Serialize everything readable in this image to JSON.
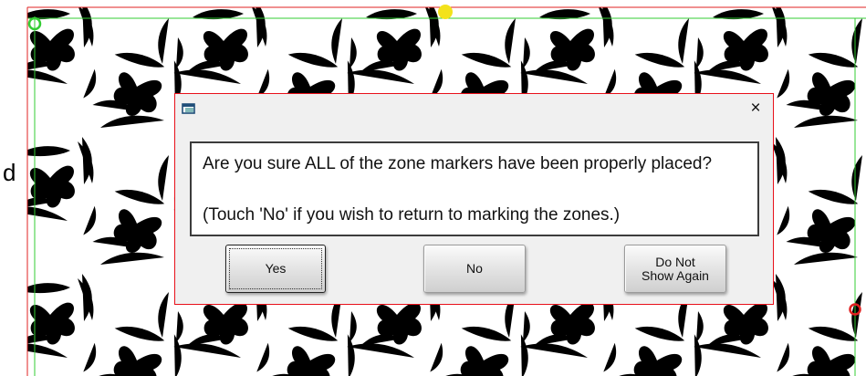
{
  "background": {
    "pattern_color": "#3b46c8",
    "boundary_color": "#33cc33",
    "edge_color": "#e02020",
    "top_marker_color": "#f3e21b",
    "corner_marker_tl_color": "#33cc33",
    "corner_marker_br_color": "#e02020",
    "side_letter": "d"
  },
  "dialog": {
    "app_icon": "window-icon",
    "close_label": "×",
    "border_color": "#e8101a",
    "message_line_1": "Are you sure ALL of the zone markers have been properly placed?",
    "message_line_2": "(Touch 'No' if you wish to return to marking the zones.)",
    "buttons": {
      "yes": "Yes",
      "no": "No",
      "do_not_show_again_line_1": "Do Not",
      "do_not_show_again_line_2": "Show Again"
    }
  }
}
